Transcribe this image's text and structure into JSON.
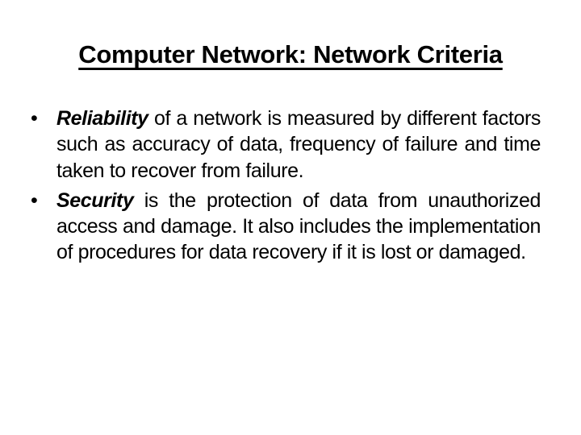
{
  "slide": {
    "title": "Computer Network: Network Criteria",
    "bullets": [
      {
        "marker": "•",
        "term": "Reliability",
        "text": " of a network is measured by different factors such as accuracy of data, frequency of failure and time taken to recover from failure."
      },
      {
        "marker": "•",
        "term": "Security",
        "text": " is the protection of data from unauthorized access and damage. It also includes the implementation of procedures for data recovery if it is lost or damaged."
      }
    ]
  }
}
